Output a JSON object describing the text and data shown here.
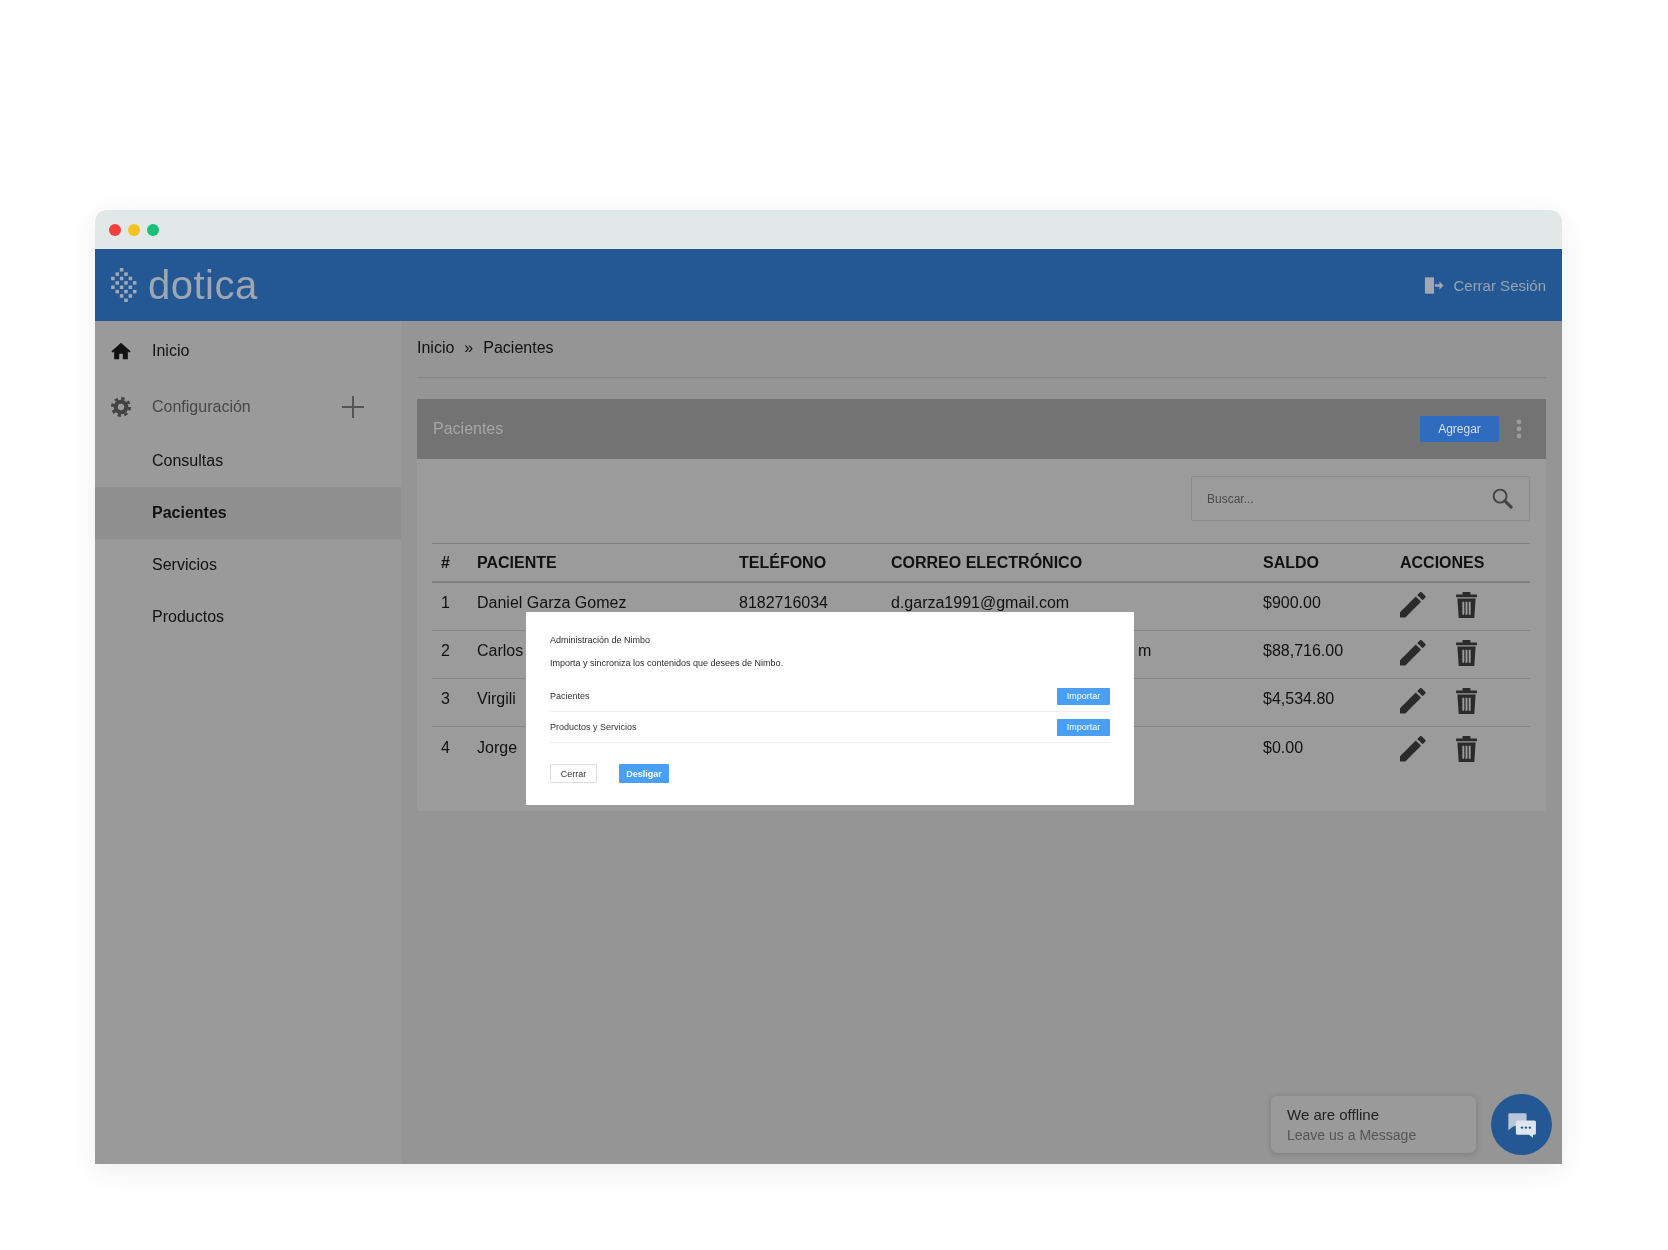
{
  "header": {
    "logo": "dotica",
    "logout": "Cerrar Sesión"
  },
  "sidebar": {
    "items": [
      {
        "label": "Inicio",
        "kind": "home",
        "selected": false
      },
      {
        "label": "Configuración",
        "kind": "group",
        "expanded": false,
        "selected": false
      },
      {
        "label": "Consultas",
        "kind": "page",
        "selected": false
      },
      {
        "label": "Pacientes",
        "kind": "page",
        "selected": true
      },
      {
        "label": "Servicios",
        "kind": "page",
        "selected": false
      },
      {
        "label": "Productos",
        "kind": "page",
        "selected": false
      }
    ]
  },
  "breadcrumb": {
    "items": [
      "Inicio",
      "Pacientes"
    ],
    "separator": "»"
  },
  "card": {
    "title": "Pacientes",
    "add_button": "Agregar",
    "search": {
      "placeholder": "Buscar..."
    },
    "table": {
      "columns": [
        "#",
        "PACIENTE",
        "TELÉFONO",
        "CORREO ELECTRÓNICO",
        "SALDO",
        "ACCIONES"
      ],
      "rows": [
        {
          "number": "1",
          "patient": "Daniel Garza Gomez",
          "phone": "8182716034",
          "email": "d.garza1991@gmail.com",
          "balance": "$900.00"
        },
        {
          "number": "2",
          "patient": "Carlos",
          "email_tail": "m",
          "balance": "$88,716.00"
        },
        {
          "number": "3",
          "patient": "Virgili",
          "balance": "$4,534.80"
        },
        {
          "number": "4",
          "patient": "Jorge",
          "balance": "$0.00"
        }
      ]
    }
  },
  "dialog": {
    "title": "Administración de Nimbo",
    "description": "Importa y sincroniza los contenidos que desees de Nimbo.",
    "rows": [
      {
        "label": "Pacientes",
        "button": "Importar"
      },
      {
        "label": "Productos y Servicios",
        "button": "Importar"
      }
    ],
    "buttons": [
      {
        "label": "Cerrar",
        "kind": "outline"
      },
      {
        "label": "Desligar",
        "kind": "filled"
      }
    ]
  },
  "chat": {
    "title": "We are offline",
    "subtitle": "Leave us a Message"
  }
}
